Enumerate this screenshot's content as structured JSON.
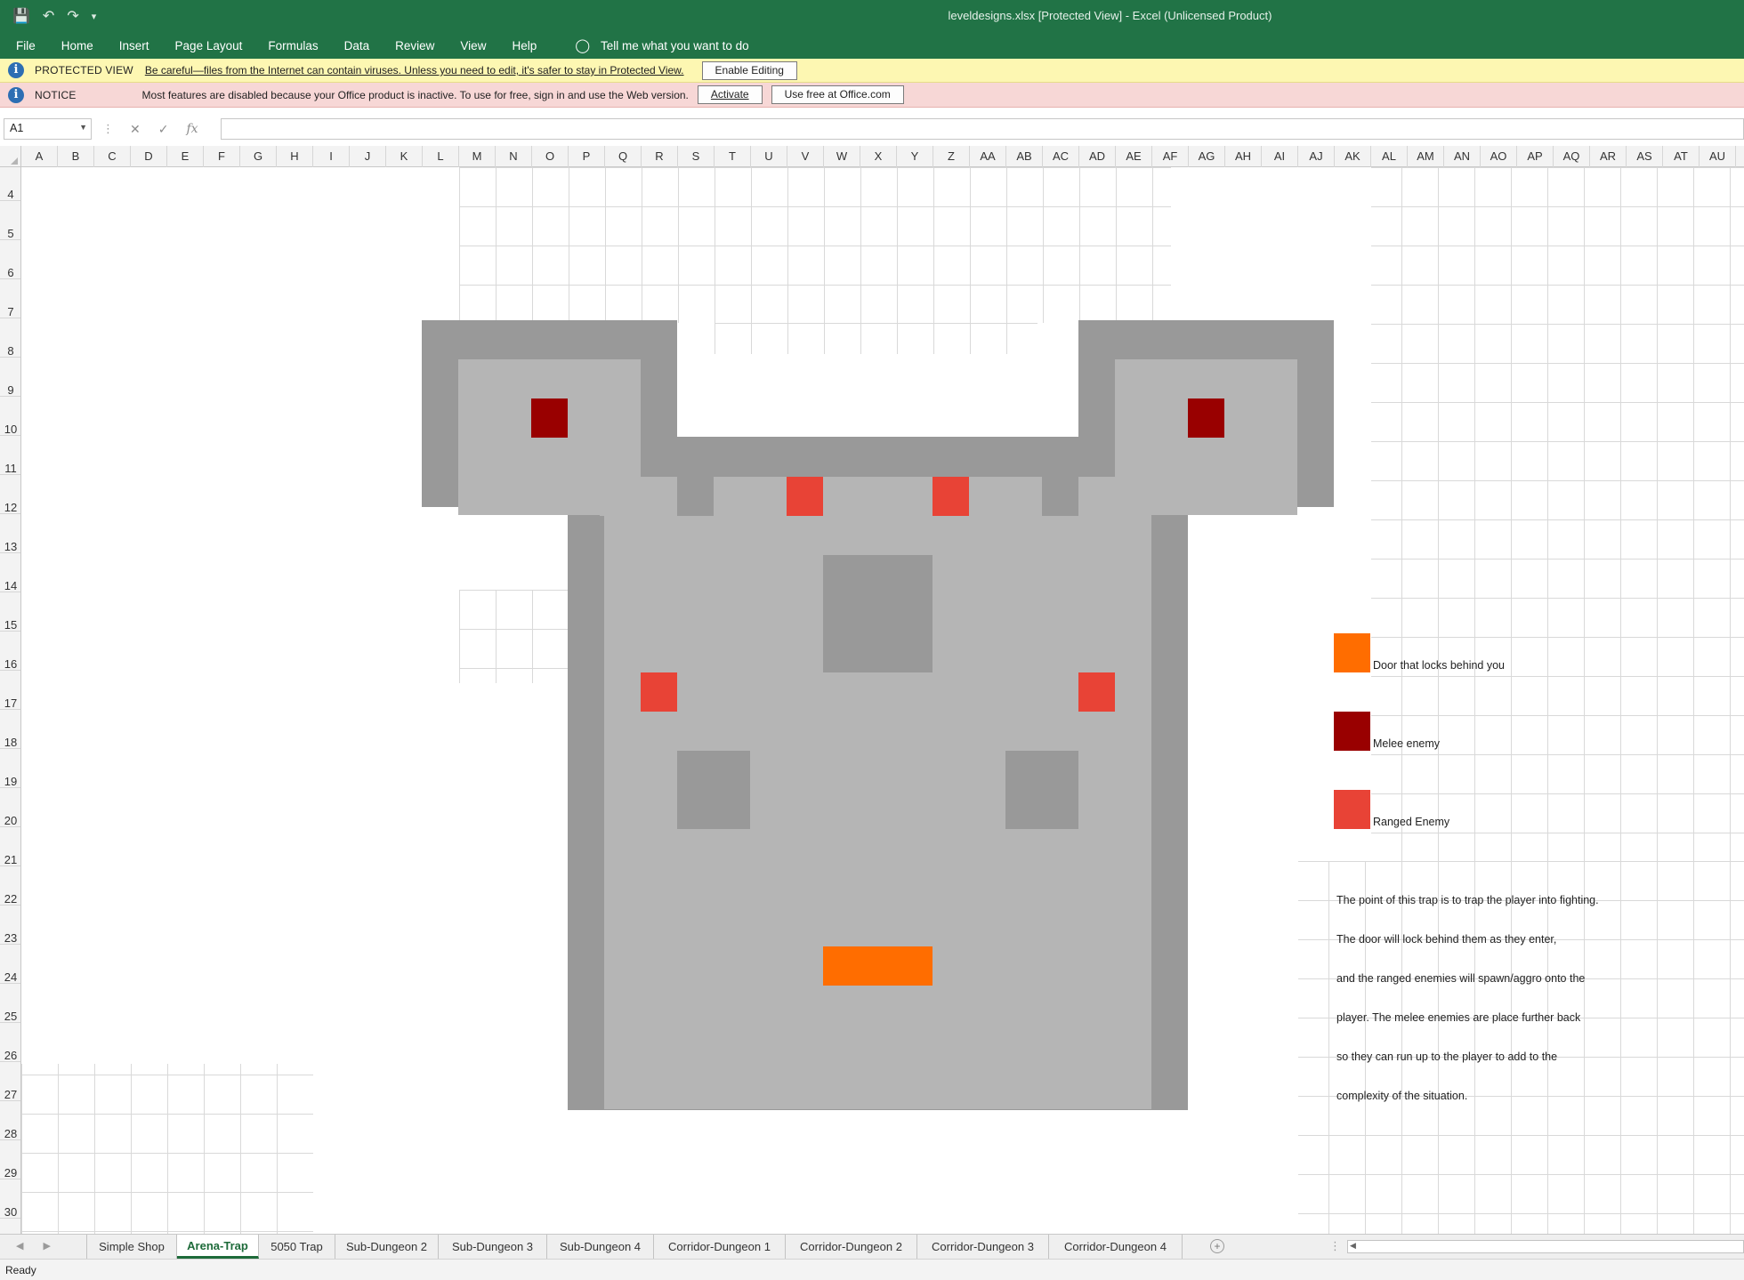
{
  "window": {
    "title": "leveldesigns.xlsx  [Protected View]  -  Excel (Unlicensed Product)",
    "qat_icons": [
      "save-icon",
      "undo-icon",
      "redo-icon",
      "customize-qat-icon"
    ]
  },
  "menu": {
    "items": [
      "File",
      "Home",
      "Insert",
      "Page Layout",
      "Formulas",
      "Data",
      "Review",
      "View",
      "Help"
    ],
    "tell_me": "Tell me what you want to do"
  },
  "protected_view": {
    "title": "PROTECTED VIEW",
    "message": "Be careful—files from the Internet can contain viruses. Unless you need to edit, it's safer to stay in Protected View.",
    "button": "Enable Editing"
  },
  "notice": {
    "title": "NOTICE",
    "message": "Most features are disabled because your Office product is inactive. To use for free, sign in and use the Web version.",
    "activate_button": "Activate",
    "web_button": "Use free at Office.com"
  },
  "formula_bar": {
    "name_box": "A1",
    "formula": ""
  },
  "grid": {
    "columns": [
      "A",
      "B",
      "C",
      "D",
      "E",
      "F",
      "G",
      "H",
      "I",
      "J",
      "K",
      "L",
      "M",
      "N",
      "O",
      "P",
      "Q",
      "R",
      "S",
      "T",
      "U",
      "V",
      "W",
      "X",
      "Y",
      "Z",
      "AA",
      "AB",
      "AC",
      "AD",
      "AE",
      "AF",
      "AG",
      "AH",
      "AI",
      "AJ",
      "AK",
      "AL",
      "AM",
      "AN",
      "AO",
      "AP",
      "AQ",
      "AR",
      "AS",
      "AT",
      "AU"
    ],
    "rows": [
      "4",
      "5",
      "6",
      "7",
      "8",
      "9",
      "10",
      "11",
      "12",
      "13",
      "14",
      "15",
      "16",
      "17",
      "18",
      "19",
      "20",
      "21",
      "22",
      "23",
      "24",
      "25",
      "26",
      "27",
      "28",
      "29",
      "30"
    ]
  },
  "legend": {
    "door": "Door that locks behind you",
    "melee": "Melee enemy",
    "ranged": "Ranged Enemy"
  },
  "notes": [
    "The point of this trap is to trap the player into fighting.",
    "The door will lock behind them as they enter,",
    "and the ranged enemies will spawn/aggro onto the",
    "player. The melee enemies are place further back",
    "so they can run up to the player to add to the",
    "complexity of the situation."
  ],
  "colors": {
    "wall": "#999999",
    "floor": "#b5b5b5",
    "melee": "#990000",
    "ranged": "#e84336",
    "door": "#ff6d00",
    "excel_green": "#217346"
  },
  "sheet_tabs": [
    "Simple Shop",
    "Arena-Trap",
    "5050 Trap",
    "Sub-Dungeon 2",
    "Sub-Dungeon 3",
    "Sub-Dungeon 4",
    "Corridor-Dungeon 1",
    "Corridor-Dungeon 2",
    "Corridor-Dungeon 3",
    "Corridor-Dungeon 4"
  ],
  "active_tab": "Arena-Trap",
  "status": "Ready"
}
